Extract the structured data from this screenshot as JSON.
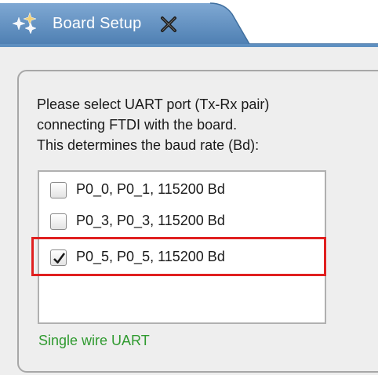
{
  "tab": {
    "title": "Board Setup",
    "icon": "gear-cluster-icon",
    "close_icon": "close-icon"
  },
  "prompt": {
    "lines": [
      "Please select UART port (Tx-Rx pair)",
      "connecting FTDI with the board.",
      "This determines the baud rate (Bd):"
    ]
  },
  "uart_options": [
    {
      "label": "P0_0, P0_1, 115200 Bd",
      "checked": false
    },
    {
      "label": "P0_3, P0_3, 115200 Bd",
      "checked": false
    },
    {
      "label": "P0_5, P0_5, 115200 Bd",
      "checked": true
    }
  ],
  "status": {
    "text": "Single wire UART",
    "color": "#2f9a2f"
  },
  "colors": {
    "tab_blue": "#5e8fc0",
    "highlight_red": "#e02020"
  }
}
